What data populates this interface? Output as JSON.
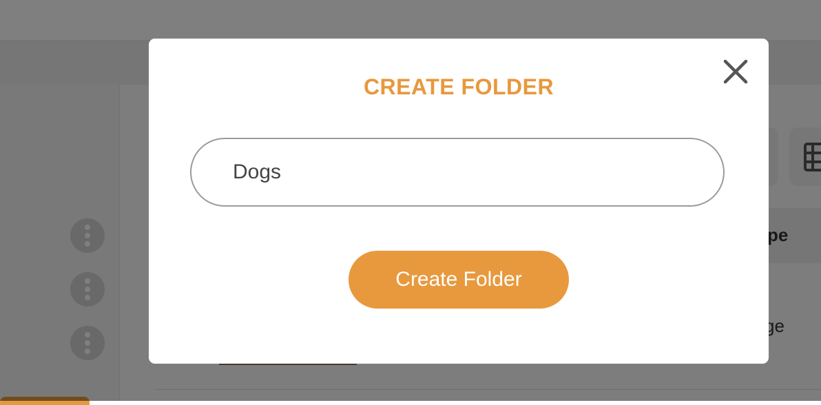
{
  "background": {
    "table": {
      "header_partial": "pe",
      "row_partial": "ge"
    },
    "icons": {
      "kebab": "kebab-menu-icon",
      "grid_view": "grid-view-icon"
    }
  },
  "modal": {
    "title": "CREATE FOLDER",
    "close_icon": "close-icon",
    "folder_name_value": "Dogs",
    "submit_label": "Create Folder"
  },
  "colors": {
    "accent": "#e8993e",
    "title": "#e8983d",
    "overlay": "rgba(0,0,0,0.5)"
  }
}
